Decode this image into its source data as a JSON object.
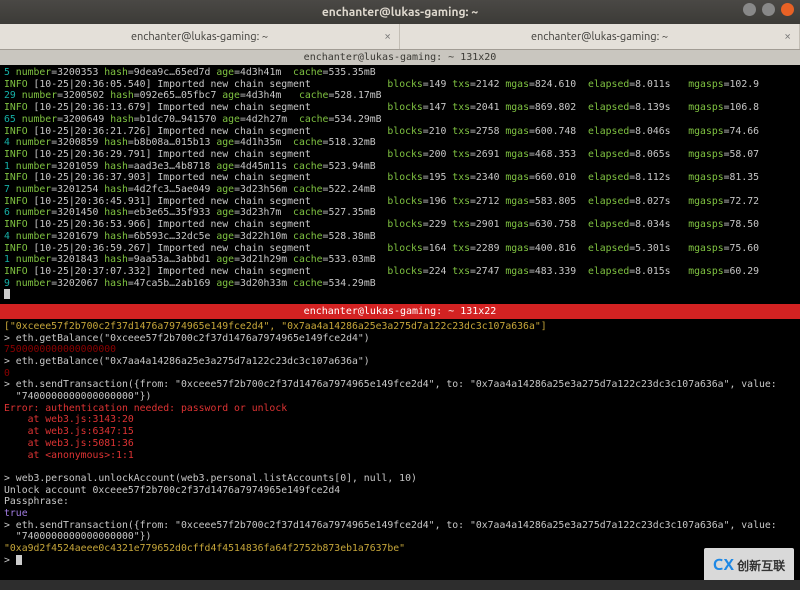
{
  "titlebar": {
    "title": "enchanter@lukas-gaming: ~"
  },
  "tabs": [
    {
      "label": "enchanter@lukas-gaming: ~",
      "close": "×"
    },
    {
      "label": "enchanter@lukas-gaming: ~",
      "close": "×"
    }
  ],
  "pane1": {
    "title": "enchanter@lukas-gaming: ~ 131x20",
    "rows": [
      {
        "n": "5 ",
        "num": "3200353",
        "hash": "9dea9c…65ed7d",
        "age": "4d3h41m ",
        "cache": "535.35mB",
        "blocks": "",
        "txs": "",
        "mgas": "",
        "elapsed": "",
        "mgasps": ""
      },
      {
        "info": "INFO ",
        "ts": "[10-25|20:36:05.540] Imported new chain segment             ",
        "blocks": "149",
        "txs": "2142",
        "mgas": "824.610  ",
        "elapsed": "8.011s   ",
        "mgasps": "102.9"
      },
      {
        "n": "29 ",
        "num": "3200502",
        "hash": "092e65…05fbc7",
        "age": "4d3h4m  ",
        "cache": "528.17mB",
        "blocks": "",
        "txs": "",
        "mgas": "",
        "elapsed": "",
        "mgasps": ""
      },
      {
        "info": "INFO ",
        "ts": "[10-25|20:36:13.679] Imported new chain segment             ",
        "blocks": "147",
        "txs": "2041",
        "mgas": "869.802  ",
        "elapsed": "8.139s   ",
        "mgasps": "106.8"
      },
      {
        "n": "65 ",
        "num": "3200649",
        "hash": "b1dc70…941570",
        "age": "4d2h27m ",
        "cache": "534.29mB",
        "blocks": "",
        "txs": "",
        "mgas": "",
        "elapsed": "",
        "mgasps": ""
      },
      {
        "info": "INFO ",
        "ts": "[10-25|20:36:21.726] Imported new chain segment             ",
        "blocks": "210",
        "txs": "2758",
        "mgas": "600.748  ",
        "elapsed": "8.046s   ",
        "mgasps": "74.66"
      },
      {
        "n": "4 ",
        "num": "3200859",
        "hash": "b8b08a…015b13",
        "age": "4d1h35m ",
        "cache": "518.32mB",
        "blocks": "",
        "txs": "",
        "mgas": "",
        "elapsed": "",
        "mgasps": ""
      },
      {
        "info": "INFO ",
        "ts": "[10-25|20:36:29.791] Imported new chain segment             ",
        "blocks": "200",
        "txs": "2691",
        "mgas": "468.353  ",
        "elapsed": "8.065s   ",
        "mgasps": "58.07"
      },
      {
        "n": "1 ",
        "num": "3201059",
        "hash": "aad3e3…4b8718",
        "age": "4d45m11s",
        "cache": "523.94mB",
        "blocks": "",
        "txs": "",
        "mgas": "",
        "elapsed": "",
        "mgasps": ""
      },
      {
        "info": "INFO ",
        "ts": "[10-25|20:36:37.903] Imported new chain segment             ",
        "blocks": "195",
        "txs": "2340",
        "mgas": "660.010  ",
        "elapsed": "8.112s   ",
        "mgasps": "81.35"
      },
      {
        "n": "7 ",
        "num": "3201254",
        "hash": "4d2fc3…5ae049",
        "age": "3d23h56m",
        "cache": "522.24mB",
        "blocks": "",
        "txs": "",
        "mgas": "",
        "elapsed": "",
        "mgasps": ""
      },
      {
        "info": "INFO ",
        "ts": "[10-25|20:36:45.931] Imported new chain segment             ",
        "blocks": "196",
        "txs": "2712",
        "mgas": "583.805  ",
        "elapsed": "8.027s   ",
        "mgasps": "72.72"
      },
      {
        "n": "6 ",
        "num": "3201450",
        "hash": "eb3e65…35f933",
        "age": "3d23h7m ",
        "cache": "527.35mB",
        "blocks": "",
        "txs": "",
        "mgas": "",
        "elapsed": "",
        "mgasps": ""
      },
      {
        "info": "INFO ",
        "ts": "[10-25|20:36:53.966] Imported new chain segment             ",
        "blocks": "229",
        "txs": "2901",
        "mgas": "630.758  ",
        "elapsed": "8.034s   ",
        "mgasps": "78.50"
      },
      {
        "n": "4 ",
        "num": "3201679",
        "hash": "6b593c…32dc5e",
        "age": "3d22h10m",
        "cache": "528.38mB",
        "blocks": "",
        "txs": "",
        "mgas": "",
        "elapsed": "",
        "mgasps": ""
      },
      {
        "info": "INFO ",
        "ts": "[10-25|20:36:59.267] Imported new chain segment             ",
        "blocks": "164",
        "txs": "2289",
        "mgas": "400.816  ",
        "elapsed": "5.301s   ",
        "mgasps": "75.60"
      },
      {
        "n": "1 ",
        "num": "3201843",
        "hash": "9aa53a…3abbd1",
        "age": "3d21h29m",
        "cache": "533.03mB",
        "blocks": "",
        "txs": "",
        "mgas": "",
        "elapsed": "",
        "mgasps": ""
      },
      {
        "info": "INFO ",
        "ts": "[10-25|20:37:07.332] Imported new chain segment             ",
        "blocks": "224",
        "txs": "2747",
        "mgas": "483.339  ",
        "elapsed": "8.015s   ",
        "mgasps": "60.29"
      },
      {
        "n": "9 ",
        "num": "3202067",
        "hash": "47ca5b…2ab169",
        "age": "3d20h33m",
        "cache": "534.29mB",
        "blocks": "",
        "txs": "",
        "mgas": "",
        "elapsed": "",
        "mgasps": ""
      }
    ],
    "cursor": "█"
  },
  "pane2": {
    "title": "enchanter@lukas-gaming: ~ 131x22",
    "lines": {
      "accts": "[\"0xceee57f2b700c2f37d1476a7974965e149fce2d4\", \"0x7aa4a14286a25e3a275d7a122c23dc3c107a636a\"]",
      "getBal1": "> eth.getBalance(\"0xceee57f2b700c2f37d1476a7974965e149fce2d4\")",
      "bal1": "7500000000000000000",
      "getBal2": "> eth.getBalance(\"0x7aa4a14286a25e3a275d7a122c23dc3c107a636a\")",
      "bal2": "0",
      "send1a": "> eth.sendTransaction({from: \"0xceee57f2b700c2f37d1476a7974965e149fce2d4\", to: \"0x7aa4a14286a25e3a275d7a122c23dc3c107a636a\", value:",
      "send1b": "  \"7400000000000000000\"})",
      "err": "Error: authentication needed: password or unlock",
      "at1": "    at web3.js:3143:20",
      "at2": "    at web3.js:6347:15",
      "at3": "    at web3.js:5081:36",
      "at4": "    at <anonymous>:1:1",
      "blank": "",
      "unlock": "> web3.personal.unlockAccount(web3.personal.listAccounts[0], null, 10)",
      "unlockEcho": "Unlock account 0xceee57f2b700c2f37d1476a7974965e149fce2d4",
      "pass": "Passphrase:",
      "true": "true",
      "send2a": "> eth.sendTransaction({from: \"0xceee57f2b700c2f37d1476a7974965e149fce2d4\", to: \"0x7aa4a14286a25e3a275d7a122c23dc3c107a636a\", value:",
      "send2b": "  \"7400000000000000000\"})",
      "txhash": "\"0xa9d2f4524aeee0c4321e779652d0cffd4f4514836fa64f2752b873eb1a7637be\"",
      "prompt": "> "
    }
  },
  "watermark": {
    "cx": "CX",
    "text": "创新互联"
  }
}
